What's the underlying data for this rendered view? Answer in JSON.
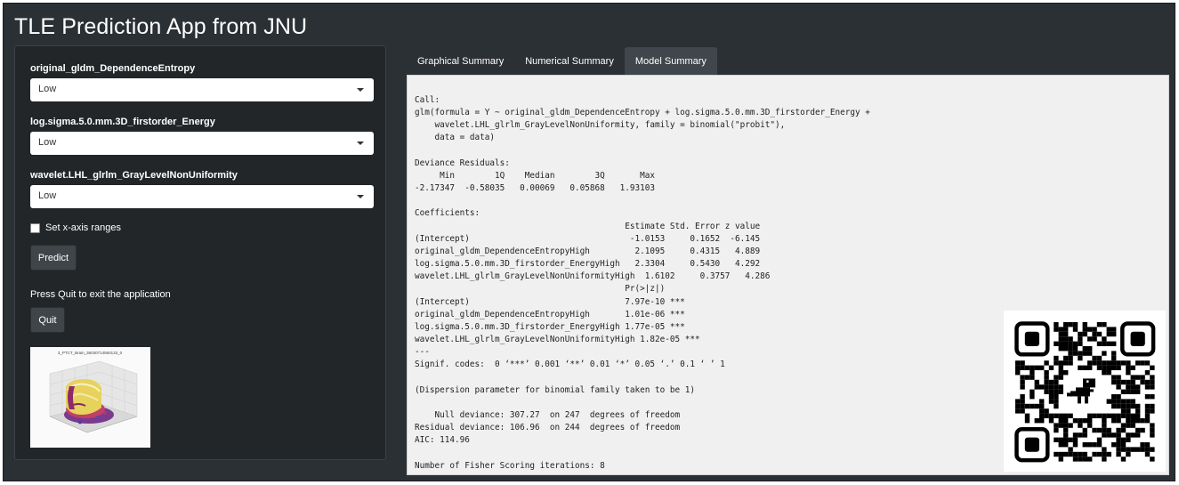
{
  "app": {
    "title": "TLE Prediction App from JNU"
  },
  "sidebar": {
    "inputs": [
      {
        "label": "original_gldm_DependenceEntropy",
        "value": "Low"
      },
      {
        "label": "log.sigma.5.0.mm.3D_firstorder_Energy",
        "value": "Low"
      },
      {
        "label": "wavelet.LHL_glrlm_GrayLevelNonUniformity",
        "value": "Low"
      }
    ],
    "checkbox": {
      "label": "Set x-axis ranges",
      "checked": false
    },
    "predict_label": "Predict",
    "quit_text": "Press Quit to exit the application",
    "quit_label": "Quit",
    "plot_title": "3_PTCT_Brain_36030714560133_0"
  },
  "tabs": [
    {
      "label": "Graphical Summary",
      "active": false
    },
    {
      "label": "Numerical Summary",
      "active": false
    },
    {
      "label": "Model Summary",
      "active": true
    }
  ],
  "model_summary": {
    "lines": [
      "Call:",
      "glm(formula = Y ~ original_gldm_DependenceEntropy + log.sigma.5.0.mm.3D_firstorder_Energy +",
      "    wavelet.LHL_glrlm_GrayLevelNonUniformity, family = binomial(\"probit\"),",
      "    data = data)",
      "",
      "Deviance Residuals:",
      "     Min        1Q    Median        3Q       Max",
      "-2.17347  -0.58035   0.00069   0.05868   1.93103",
      "",
      "Coefficients:",
      "                                          Estimate Std. Error z value",
      "(Intercept)                                -1.0153     0.1652  -6.145",
      "original_gldm_DependenceEntropyHigh         2.1095     0.4315   4.889",
      "log.sigma.5.0.mm.3D_firstorder_EnergyHigh   2.3304     0.5430   4.292",
      "wavelet.LHL_glrlm_GrayLevelNonUniformityHigh  1.6102     0.3757   4.286",
      "                                          Pr(>|z|)",
      "(Intercept)                               7.97e-10 ***",
      "original_gldm_DependenceEntropyHigh       1.01e-06 ***",
      "log.sigma.5.0.mm.3D_firstorder_EnergyHigh 1.77e-05 ***",
      "wavelet.LHL_glrlm_GrayLevelNonUniformityHigh 1.82e-05 ***",
      "---",
      "Signif. codes:  0 ‘***’ 0.001 ‘**’ 0.01 ‘*’ 0.05 ‘.’ 0.1 ‘ ’ 1",
      "",
      "(Dispersion parameter for binomial family taken to be 1)",
      "",
      "    Null deviance: 307.27  on 247  degrees of freedom",
      "Residual deviance: 106.96  on 244  degrees of freedom",
      "AIC: 114.96",
      "",
      "Number of Fisher Scoring iterations: 8"
    ]
  },
  "colors": {
    "background": "#2b3035",
    "sidebar": "#222628",
    "active_tab": "#40464c",
    "output_bg": "#f0f0f0"
  }
}
